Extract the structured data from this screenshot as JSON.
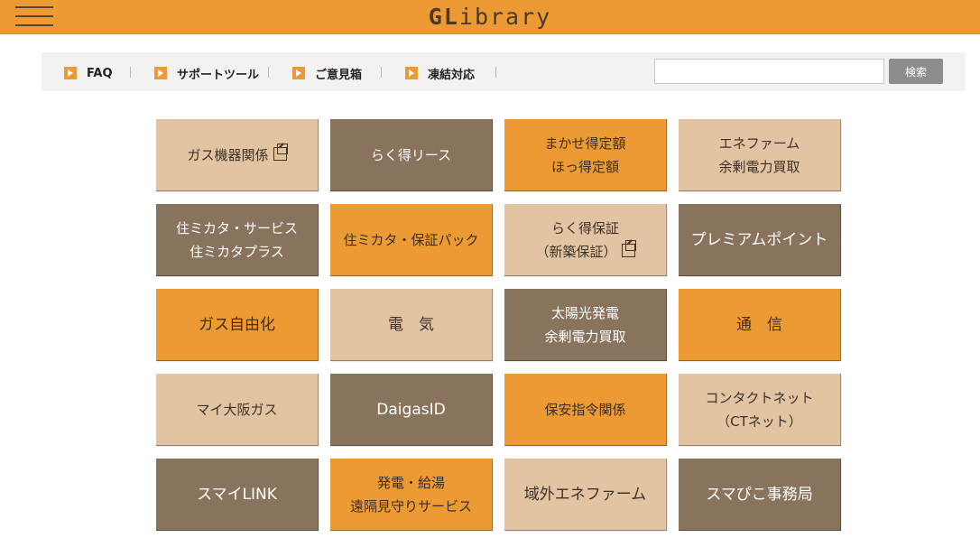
{
  "header": {
    "brand_bold": "GL",
    "brand_rest": "ibrary",
    "accent_color": "#ec9a33"
  },
  "nav": {
    "items": [
      {
        "label": "FAQ"
      },
      {
        "label": "サポートツール"
      },
      {
        "label": "ご意見箱"
      },
      {
        "label": "凍結対応"
      }
    ],
    "search": {
      "value": "",
      "placeholder": "",
      "button_label": "検索"
    }
  },
  "tiles": [
    {
      "lines": [
        "ガス機器関係"
      ],
      "color": "beige",
      "external": true
    },
    {
      "lines": [
        "らく得リース"
      ],
      "color": "brown",
      "external": false
    },
    {
      "lines": [
        "まかせ得定額",
        "ほっ得定額"
      ],
      "color": "orange",
      "external": false
    },
    {
      "lines": [
        "エネファーム",
        "余剰電力買取"
      ],
      "color": "beige",
      "external": false
    },
    {
      "lines": [
        "住ミカタ・サービス",
        "住ミカタプラス"
      ],
      "color": "brown",
      "external": false
    },
    {
      "lines": [
        "住ミカタ・保証パック"
      ],
      "color": "orange",
      "external": false
    },
    {
      "lines": [
        "らく得保証",
        "（新築保証）"
      ],
      "color": "beige",
      "external": true
    },
    {
      "lines": [
        "プレミアムポイント"
      ],
      "color": "brown",
      "external": false
    },
    {
      "lines": [
        "ガス自由化"
      ],
      "color": "orange",
      "external": false
    },
    {
      "lines": [
        "電　気"
      ],
      "color": "beige",
      "external": false
    },
    {
      "lines": [
        "太陽光発電",
        "余剰電力買取"
      ],
      "color": "brown",
      "external": false
    },
    {
      "lines": [
        "通　信"
      ],
      "color": "orange",
      "external": false
    },
    {
      "lines": [
        "マイ大阪ガス"
      ],
      "color": "beige",
      "external": false
    },
    {
      "lines": [
        "DaigasID"
      ],
      "color": "brown",
      "external": false
    },
    {
      "lines": [
        "保安指令関係"
      ],
      "color": "orange",
      "external": false
    },
    {
      "lines": [
        "コンタクトネット",
        "（CTネット）"
      ],
      "color": "beige",
      "external": false
    },
    {
      "lines": [
        "スマイLINK"
      ],
      "color": "brown",
      "external": false
    },
    {
      "lines": [
        "発電・給湯",
        "遠隔見守りサービス"
      ],
      "color": "orange",
      "external": false
    },
    {
      "lines": [
        "域外エネファーム"
      ],
      "color": "beige",
      "external": false
    },
    {
      "lines": [
        "スマぴこ事務局"
      ],
      "color": "brown",
      "external": false
    }
  ]
}
